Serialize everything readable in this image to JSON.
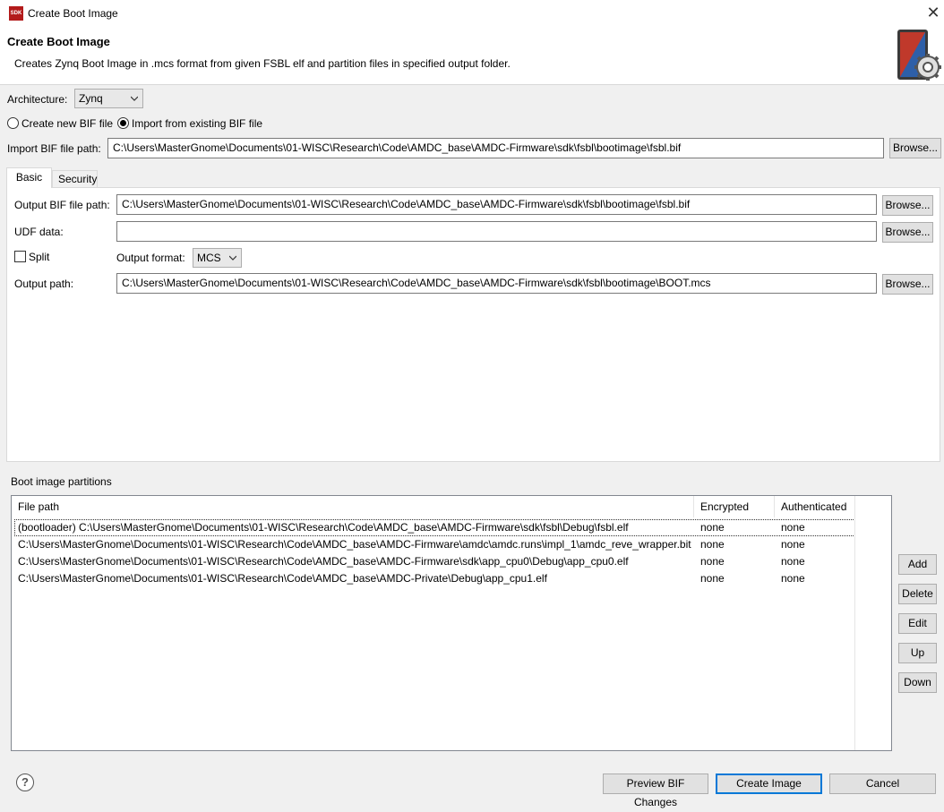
{
  "window": {
    "title": "Create Boot Image",
    "logo_text": "SDK",
    "close_glyph": "✕"
  },
  "header": {
    "title": "Create Boot Image",
    "description": "Creates Zynq Boot Image in .mcs format from given FSBL elf and partition files in specified output folder.",
    "icon": "boot-image-gear-icon"
  },
  "architecture": {
    "label": "Architecture:",
    "value": "Zynq"
  },
  "bif_mode": {
    "create_label": "Create new BIF file",
    "import_label": "Import from existing BIF file",
    "selected": "import"
  },
  "import_bif": {
    "label": "Import BIF file path:",
    "value": "C:\\Users\\MasterGnome\\Documents\\01-WISC\\Research\\Code\\AMDC_base\\AMDC-Firmware\\sdk\\fsbl\\bootimage\\fsbl.bif",
    "browse": "Browse..."
  },
  "tabs": [
    {
      "label": "Basic",
      "active": true
    },
    {
      "label": "Security",
      "active": false
    }
  ],
  "basic": {
    "output_bif_label": "Output BIF file path:",
    "output_bif_value": "C:\\Users\\MasterGnome\\Documents\\01-WISC\\Research\\Code\\AMDC_base\\AMDC-Firmware\\sdk\\fsbl\\bootimage\\fsbl.bif",
    "udf_label": "UDF data:",
    "udf_value": "",
    "split_label": "Split",
    "split_checked": false,
    "output_format_label": "Output format:",
    "output_format_value": "MCS",
    "output_path_label": "Output path:",
    "output_path_value": "C:\\Users\\MasterGnome\\Documents\\01-WISC\\Research\\Code\\AMDC_base\\AMDC-Firmware\\sdk\\fsbl\\bootimage\\BOOT.mcs",
    "browse": "Browse..."
  },
  "partitions": {
    "section_label": "Boot image partitions",
    "columns": [
      "File path",
      "Encrypted",
      "Authenticated"
    ],
    "rows": [
      {
        "path": "(bootloader) C:\\Users\\MasterGnome\\Documents\\01-WISC\\Research\\Code\\AMDC_base\\AMDC-Firmware\\sdk\\fsbl\\Debug\\fsbl.elf",
        "encrypted": "none",
        "authenticated": "none"
      },
      {
        "path": "C:\\Users\\MasterGnome\\Documents\\01-WISC\\Research\\Code\\AMDC_base\\AMDC-Firmware\\amdc\\amdc.runs\\impl_1\\amdc_reve_wrapper.bit",
        "encrypted": "none",
        "authenticated": "none"
      },
      {
        "path": "C:\\Users\\MasterGnome\\Documents\\01-WISC\\Research\\Code\\AMDC_base\\AMDC-Firmware\\sdk\\app_cpu0\\Debug\\app_cpu0.elf",
        "encrypted": "none",
        "authenticated": "none"
      },
      {
        "path": "C:\\Users\\MasterGnome\\Documents\\01-WISC\\Research\\Code\\AMDC_base\\AMDC-Private\\Debug\\app_cpu1.elf",
        "encrypted": "none",
        "authenticated": "none"
      }
    ],
    "buttons": {
      "add": "Add",
      "delete": "Delete",
      "edit": "Edit",
      "up": "Up",
      "down": "Down"
    }
  },
  "footer": {
    "help": "?",
    "preview": "Preview BIF Changes",
    "create": "Create Image",
    "cancel": "Cancel"
  }
}
